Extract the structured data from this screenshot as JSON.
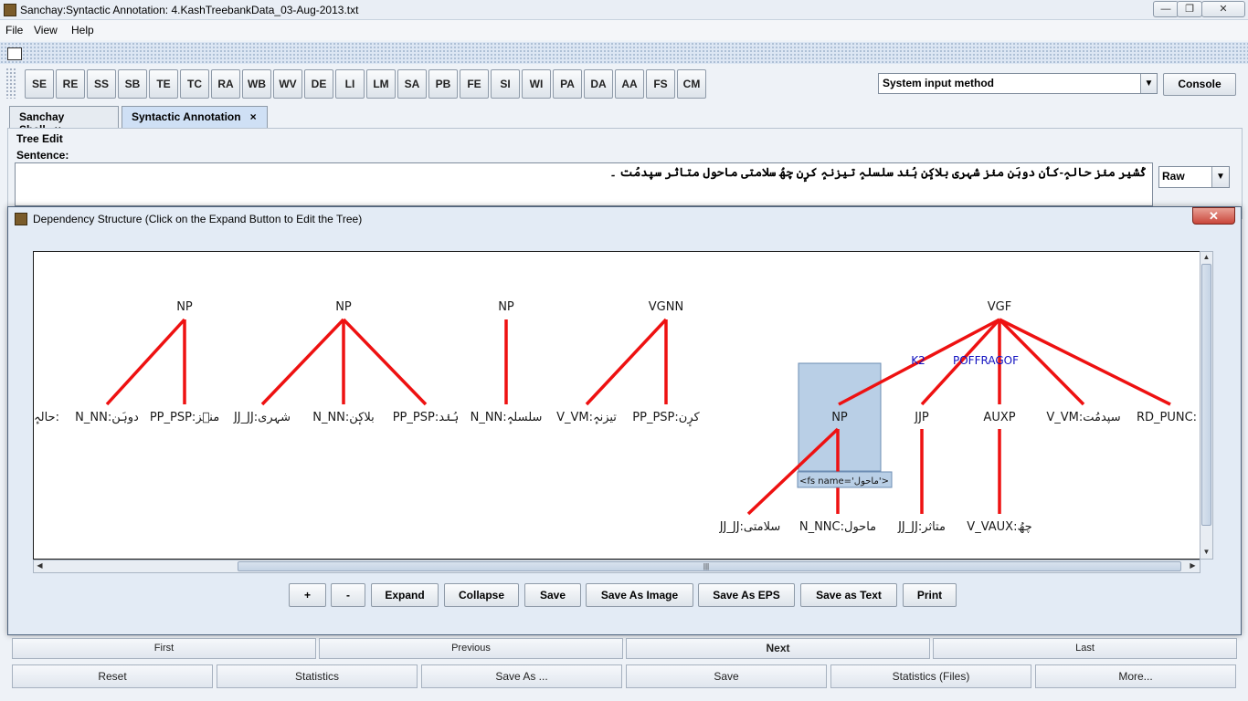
{
  "window": {
    "title": "Sanchay:Syntactic Annotation: 4.KashTreebankData_03-Aug-2013.txt",
    "controls": [
      "—",
      "❐",
      "✕"
    ]
  },
  "menu": [
    "File",
    "View",
    "Help"
  ],
  "toolbar": {
    "buttons": [
      "SE",
      "RE",
      "SS",
      "SB",
      "TE",
      "TC",
      "RA",
      "WB",
      "WV",
      "DE",
      "LI",
      "LM",
      "SA",
      "PB",
      "FE",
      "SI",
      "WI",
      "PA",
      "DA",
      "AA",
      "FS",
      "CM"
    ],
    "input_method": "System input method",
    "console_label": "Console"
  },
  "tabs": [
    {
      "label": "Sanchay Shell",
      "active": false
    },
    {
      "label": "Syntactic Annotation",
      "active": true
    }
  ],
  "tab_close": "×",
  "tree_edit": {
    "title": "Tree Edit",
    "sentence_label": "Sentence:",
    "sentence": "کٔشیر منٛز حالہٕ-کٲن دوہَن منٛز شہری بلاکٕن ہُنٛد سلسلہٕ تیزنہٕ کرٕن چھُ سلامتی ماحول متاثر سپدمُت ۔",
    "view_mode": "Raw"
  },
  "dialog": {
    "title": "Dependency Structure (Click on the Expand Button to Edit the Tree)",
    "close": "✕",
    "tree": {
      "chunks": [
        "NP",
        "NP",
        "NP",
        "VGNN",
        "VGF"
      ],
      "leaves_top": [
        "حالہٕ:",
        "N_NN:دوہَن",
        "PP_PSP:منٛز",
        "JJ_JJ:شہری",
        "N_NN:بلاکٕن",
        "PP_PSP:ہُنٛد",
        "N_NN:سلسلہٕ",
        "V_VM:تیزنہٕ",
        "PP_PSP:کرٕن"
      ],
      "vgf_children": [
        "NP",
        "JJP",
        "AUXP",
        "V_VM:سپدمُت",
        "RD_PUNC:"
      ],
      "edge_labels": [
        "K2",
        "POFFRAGOF"
      ],
      "tooltip": "<fs name='ماحول'>",
      "leaves_bottom": [
        "JJ_JJ:سلامتی",
        "N_NNC:ماحول",
        "JJ_JJ:متاثر",
        "V_VAUX:چھُ"
      ]
    },
    "buttons": [
      "+",
      "-",
      "Expand",
      "Collapse",
      "Save",
      "Save As Image",
      "Save As EPS",
      "Save as Text",
      "Print"
    ]
  },
  "nav_row1": [
    "First",
    "Previous",
    "Next",
    "Last"
  ],
  "nav_row2": [
    "Reset",
    "Statistics",
    "Save As ...",
    "Save",
    "Statistics (Files)",
    "More..."
  ],
  "scroll_arrows": {
    "up": "▲",
    "down": "▼",
    "left": "◀",
    "right": "▶",
    "grip": "|||"
  },
  "dropdown_arrow": "▼"
}
